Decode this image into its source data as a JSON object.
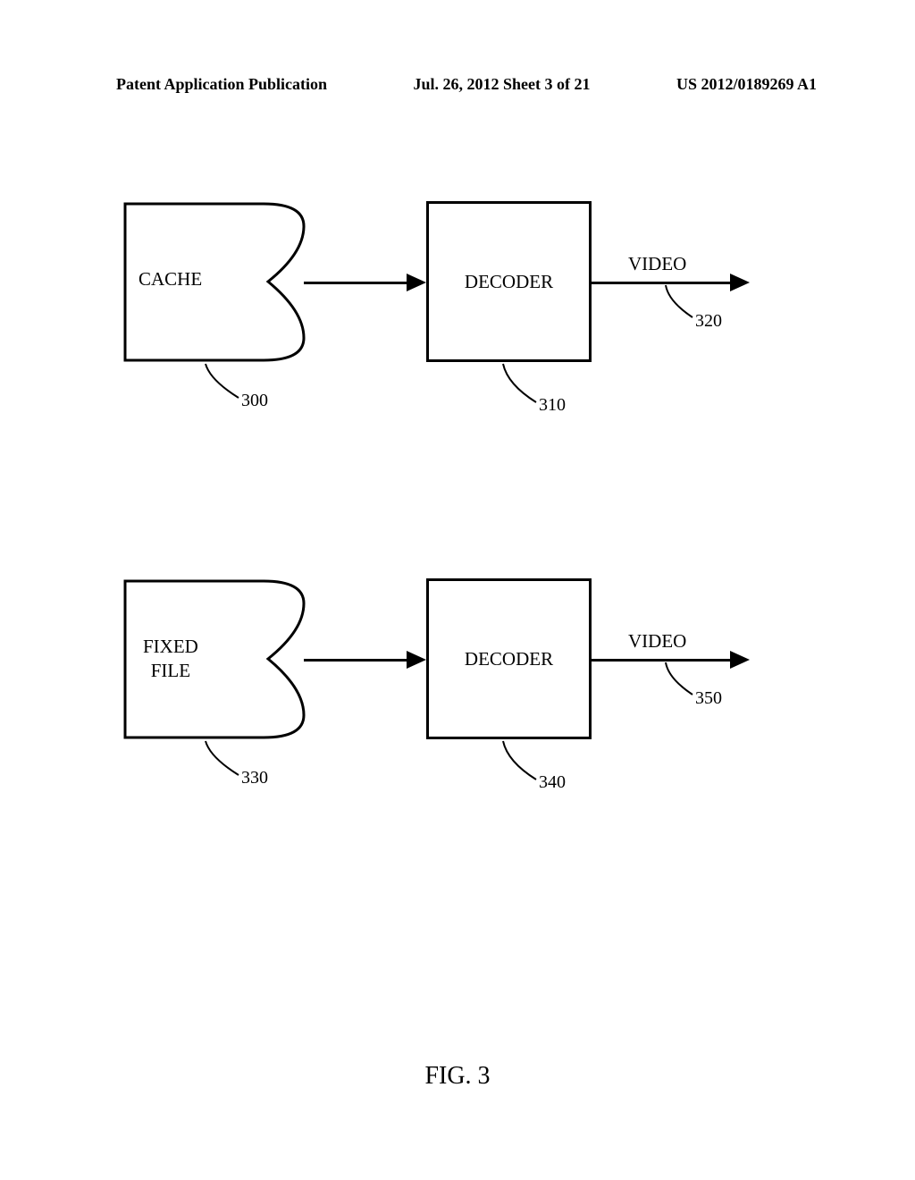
{
  "header": {
    "left": "Patent Application Publication",
    "center": "Jul. 26, 2012  Sheet 3 of 21",
    "right": "US 2012/0189269 A1"
  },
  "diagram1": {
    "storage_label": "CACHE",
    "decoder_label": "DECODER",
    "output_label": "VIDEO",
    "ref_storage": "300",
    "ref_decoder": "310",
    "ref_output": "320"
  },
  "diagram2": {
    "storage_label": "FIXED\nFILE",
    "decoder_label": "DECODER",
    "output_label": "VIDEO",
    "ref_storage": "330",
    "ref_decoder": "340",
    "ref_output": "350"
  },
  "figure_caption": "FIG. 3"
}
